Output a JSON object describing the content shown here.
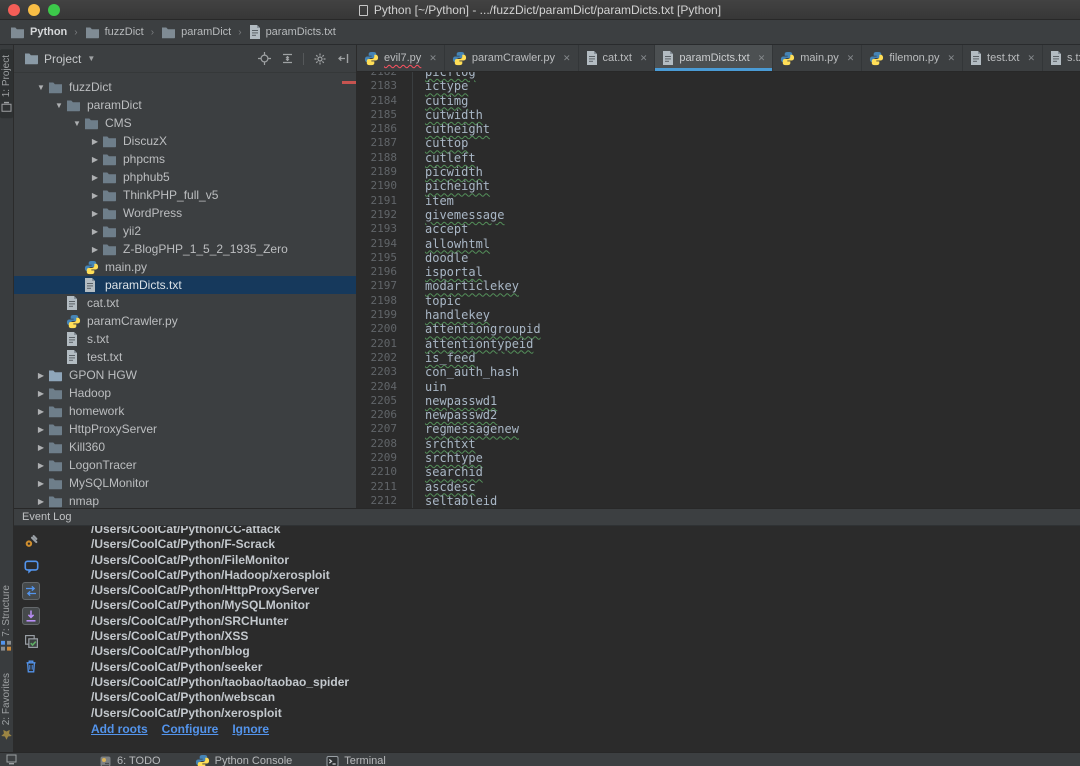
{
  "titlebar": {
    "title": "Python [~/Python] - .../fuzzDict/paramDict/paramDicts.txt [Python]"
  },
  "breadcrumbs": {
    "items": [
      {
        "label": "Python",
        "icon": "folder"
      },
      {
        "label": "fuzzDict",
        "icon": "folder"
      },
      {
        "label": "paramDict",
        "icon": "folder"
      },
      {
        "label": "paramDicts.txt",
        "icon": "txt"
      }
    ]
  },
  "left_stripe": {
    "top": [
      {
        "label": "1: Project",
        "icon": "project",
        "pressed": true
      }
    ],
    "bottom": [
      {
        "label": "7: Structure",
        "icon": "structure"
      },
      {
        "label": "2: Favorites",
        "icon": "star"
      }
    ]
  },
  "project_panel": {
    "title": "Project",
    "toolbar_icons": [
      "locate",
      "collapse-all",
      "settings",
      "hide"
    ],
    "tree": [
      {
        "label": "fuzzDict",
        "level": 0,
        "kind": "folder",
        "state": "open"
      },
      {
        "label": "paramDict",
        "level": 1,
        "kind": "folder",
        "state": "open"
      },
      {
        "label": "CMS",
        "level": 2,
        "kind": "folder",
        "state": "open"
      },
      {
        "label": "DiscuzX",
        "level": 3,
        "kind": "folder",
        "state": "closed"
      },
      {
        "label": "phpcms",
        "level": 3,
        "kind": "folder",
        "state": "closed"
      },
      {
        "label": "phphub5",
        "level": 3,
        "kind": "folder",
        "state": "closed"
      },
      {
        "label": "ThinkPHP_full_v5",
        "level": 3,
        "kind": "folder",
        "state": "closed"
      },
      {
        "label": "WordPress",
        "level": 3,
        "kind": "folder",
        "state": "closed"
      },
      {
        "label": "yii2",
        "level": 3,
        "kind": "folder",
        "state": "closed"
      },
      {
        "label": "Z-BlogPHP_1_5_2_1935_Zero",
        "level": 3,
        "kind": "folder",
        "state": "closed"
      },
      {
        "label": "main.py",
        "level": 2,
        "kind": "py"
      },
      {
        "label": "paramDicts.txt",
        "level": 2,
        "kind": "txt",
        "selected": true
      },
      {
        "label": "cat.txt",
        "level": 1,
        "kind": "txt"
      },
      {
        "label": "paramCrawler.py",
        "level": 1,
        "kind": "py"
      },
      {
        "label": "s.txt",
        "level": 1,
        "kind": "txt"
      },
      {
        "label": "test.txt",
        "level": 1,
        "kind": "txt"
      },
      {
        "label": "GPON HGW",
        "level": 0,
        "kind": "folder",
        "state": "closed",
        "bright": true
      },
      {
        "label": "Hadoop",
        "level": 0,
        "kind": "folder",
        "state": "closed"
      },
      {
        "label": "homework",
        "level": 0,
        "kind": "folder",
        "state": "closed"
      },
      {
        "label": "HttpProxyServer",
        "level": 0,
        "kind": "folder",
        "state": "closed"
      },
      {
        "label": "Kill360",
        "level": 0,
        "kind": "folder",
        "state": "closed"
      },
      {
        "label": "LogonTracer",
        "level": 0,
        "kind": "folder",
        "state": "closed"
      },
      {
        "label": "MySQLMonitor",
        "level": 0,
        "kind": "folder",
        "state": "closed"
      },
      {
        "label": "nmap",
        "level": 0,
        "kind": "folder",
        "state": "closed"
      }
    ]
  },
  "editor": {
    "tabs": [
      {
        "label": "evil7.py",
        "kind": "py",
        "error": true
      },
      {
        "label": "paramCrawler.py",
        "kind": "py"
      },
      {
        "label": "cat.txt",
        "kind": "txt"
      },
      {
        "label": "paramDicts.txt",
        "kind": "txt",
        "active": true
      },
      {
        "label": "main.py",
        "kind": "py"
      },
      {
        "label": "filemon.py",
        "kind": "py"
      },
      {
        "label": "test.txt",
        "kind": "txt"
      },
      {
        "label": "s.txt",
        "kind": "txt"
      }
    ],
    "lines": [
      {
        "n": 2182,
        "t": "picflog",
        "typo": true
      },
      {
        "n": 2183,
        "t": "ictype",
        "typo": true
      },
      {
        "n": 2184,
        "t": "cutimg",
        "typo": true
      },
      {
        "n": 2185,
        "t": "cutwidth",
        "typo": true
      },
      {
        "n": 2186,
        "t": "cutheight",
        "typo": true
      },
      {
        "n": 2187,
        "t": "cuttop",
        "typo": true
      },
      {
        "n": 2188,
        "t": "cutleft",
        "typo": true
      },
      {
        "n": 2189,
        "t": "picwidth",
        "typo": true
      },
      {
        "n": 2190,
        "t": "picheight",
        "typo": true
      },
      {
        "n": 2191,
        "t": "item",
        "typo": false
      },
      {
        "n": 2192,
        "t": "givemessage",
        "typo": true
      },
      {
        "n": 2193,
        "t": "accept",
        "typo": false
      },
      {
        "n": 2194,
        "t": "allowhtml",
        "typo": true
      },
      {
        "n": 2195,
        "t": "doodle",
        "typo": false
      },
      {
        "n": 2196,
        "t": "isportal",
        "typo": true
      },
      {
        "n": 2197,
        "t": "modarticlekey",
        "typo": true
      },
      {
        "n": 2198,
        "t": "topic",
        "typo": false
      },
      {
        "n": 2199,
        "t": "handlekey",
        "typo": true
      },
      {
        "n": 2200,
        "t": "attentiongroupid",
        "typo": true
      },
      {
        "n": 2201,
        "t": "attentiontypeid",
        "typo": true
      },
      {
        "n": 2202,
        "t": "is_feed",
        "typo": true
      },
      {
        "n": 2203,
        "t": "con_auth_hash",
        "typo": false
      },
      {
        "n": 2204,
        "t": "uin",
        "typo": false
      },
      {
        "n": 2205,
        "t": "newpasswd1",
        "typo": true
      },
      {
        "n": 2206,
        "t": "newpasswd2",
        "typo": true
      },
      {
        "n": 2207,
        "t": "regmessagenew",
        "typo": true
      },
      {
        "n": 2208,
        "t": "srchtxt",
        "typo": true
      },
      {
        "n": 2209,
        "t": "srchtype",
        "typo": true
      },
      {
        "n": 2210,
        "t": "searchid",
        "typo": true
      },
      {
        "n": 2211,
        "t": "ascdesc",
        "typo": true
      },
      {
        "n": 2212,
        "t": "seltableid",
        "typo": true
      }
    ]
  },
  "event_log": {
    "title": "Event Log",
    "toolbar_icons": [
      {
        "name": "settings",
        "selected": false
      },
      {
        "name": "balloon",
        "selected": false
      },
      {
        "name": "autoscroll",
        "selected": true
      },
      {
        "name": "scroll-end",
        "selected": true
      },
      {
        "name": "mark-read",
        "selected": false
      },
      {
        "name": "clear",
        "selected": false
      }
    ],
    "lines": [
      "/Users/CoolCat/Python/CC-attack",
      "/Users/CoolCat/Python/F-Scrack",
      "/Users/CoolCat/Python/FileMonitor",
      "/Users/CoolCat/Python/Hadoop/xerosploit",
      "/Users/CoolCat/Python/HttpProxyServer",
      "/Users/CoolCat/Python/MySQLMonitor",
      "/Users/CoolCat/Python/SRCHunter",
      "/Users/CoolCat/Python/XSS",
      "/Users/CoolCat/Python/blog",
      "/Users/CoolCat/Python/seeker",
      "/Users/CoolCat/Python/taobao/taobao_spider",
      "/Users/CoolCat/Python/webscan",
      "/Users/CoolCat/Python/xerosploit"
    ],
    "links": [
      "Add roots",
      "Configure",
      "Ignore"
    ]
  },
  "bottom_bar": {
    "items": [
      {
        "label": "6: TODO",
        "icon": "todo"
      },
      {
        "label": "Python Console",
        "icon": "python"
      },
      {
        "label": "Terminal",
        "icon": "terminal"
      }
    ]
  },
  "colors": {
    "accent_tab_underline": "#4a9bd5",
    "selection_bg": "#16395c",
    "typo_underline": "#54905a",
    "error_underline": "#ff5261",
    "link": "#5394ec",
    "traffic_red": "#f55e57",
    "traffic_yellow": "#f8bd45",
    "traffic_green": "#3cc84a"
  }
}
